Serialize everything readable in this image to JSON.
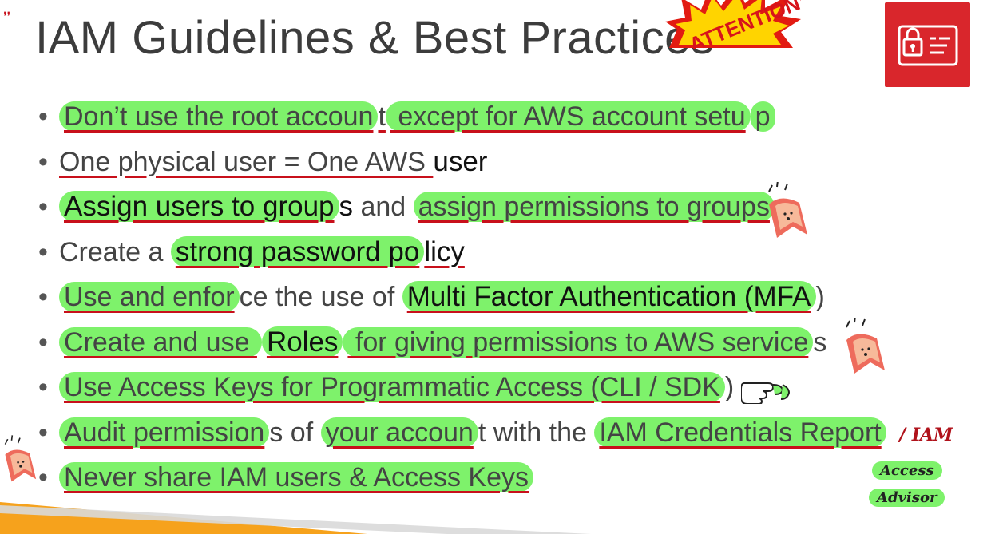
{
  "slide": {
    "title": "IAM Guidelines & Best Practices",
    "attention_sticker": "ATTENTION!",
    "corner_mark": ",,"
  },
  "bullets": [
    {
      "parts": [
        [
          "hl ul light",
          "Don’t use the root accoun"
        ],
        [
          "ul light",
          "t"
        ],
        [
          "hl ul light",
          " except for AWS account setu"
        ],
        [
          "hl light",
          "p"
        ]
      ]
    },
    {
      "parts": [
        [
          "ul light",
          "One physical user = One AWS "
        ],
        [
          "bold",
          "user"
        ]
      ]
    },
    {
      "parts": [
        [
          "hl ul bold",
          "Assign users to group"
        ],
        [
          "bold",
          "s"
        ],
        [
          "light",
          " and "
        ],
        [
          "hl ul light",
          "assign permissions to groups "
        ]
      ]
    },
    {
      "parts": [
        [
          "light",
          "Create a "
        ],
        [
          "hl ul bold",
          "strong password po"
        ],
        [
          "ul bold",
          "licy"
        ]
      ]
    },
    {
      "parts": [
        [
          "hl ul light",
          "Use and enfor"
        ],
        [
          "light",
          "ce the use of "
        ],
        [
          "hl ul bold",
          "Multi Factor Authentication (MFA"
        ],
        [
          "light",
          ")"
        ]
      ]
    },
    {
      "parts": [
        [
          "hl ul light",
          "Create and use "
        ],
        [
          "hl ul bold",
          "Roles"
        ],
        [
          "hl ul light",
          " for giving permissions to AWS service"
        ],
        [
          "light",
          "s"
        ]
      ]
    },
    {
      "parts": [
        [
          "hl ul light",
          "Use Access Keys for Programmatic Access (CLI / SDK"
        ],
        [
          "light",
          ")"
        ]
      ]
    },
    {
      "parts": [
        [
          "hl ul light",
          "Audit permission"
        ],
        [
          "light",
          "s of "
        ],
        [
          "hl ul light",
          "your accoun"
        ],
        [
          "light",
          "t with the "
        ],
        [
          "hl ul light",
          "IAM Credentials Report "
        ]
      ]
    },
    {
      "parts": [
        [
          "hl ul light",
          "Never share IAM users & Access Keys "
        ]
      ]
    }
  ],
  "annotations": {
    "iam_note": "/ IAM",
    "access_note": "Access",
    "advisor_note": "Advisor"
  },
  "colors": {
    "highlight": "#7ef26b",
    "underline": "#c8101b",
    "logo_bg": "#d9262c",
    "footer_orange": "#f6a21c"
  }
}
